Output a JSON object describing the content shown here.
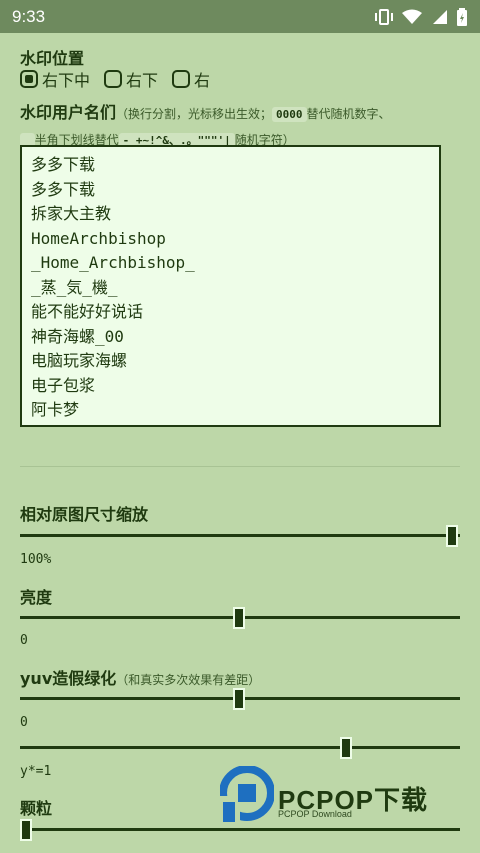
{
  "status": {
    "time": "9:33"
  },
  "position": {
    "title": "水印位置",
    "options": [
      "右下中",
      "右下",
      "右"
    ],
    "selected": 0
  },
  "usernames": {
    "title": "水印用户名们",
    "note_a": "（换行分割，光标移出生效；",
    "code_a": "0000",
    "note_b": "替代随机数字、",
    "code_b": "_",
    "note_c": "半角下划线替代",
    "code_c": "-_+~!^&、.。\"\"\"'|",
    "note_d": "随机字符）",
    "lines": [
      "多多下载",
      "多多下载",
      "拆家大主教",
      "HomeArchbishop",
      "_Home_Archbishop_",
      "_蒸_気_機_",
      "能不能好好说话",
      "神奇海螺_00",
      "电脑玩家海螺",
      "电子包浆",
      "阿卡梦"
    ]
  },
  "sliders": {
    "scale": {
      "label": "相对原图尺寸缩放",
      "value_text": "100%",
      "fraction": 1.0
    },
    "brightness": {
      "label": "亮度",
      "value_text": "0",
      "fraction": 0.5
    },
    "yuv": {
      "label": "yuv造假绿化",
      "note": "（和真实多次效果有差距）",
      "value_text": "0",
      "fraction": 0.5
    },
    "gamma": {
      "value_text": "y*=1",
      "fraction": 0.75
    },
    "grain": {
      "label": "颗粒",
      "fraction": 0.0
    }
  },
  "watermark": {
    "brand": "PCPOP下载",
    "sub": "PCPOP Download"
  }
}
